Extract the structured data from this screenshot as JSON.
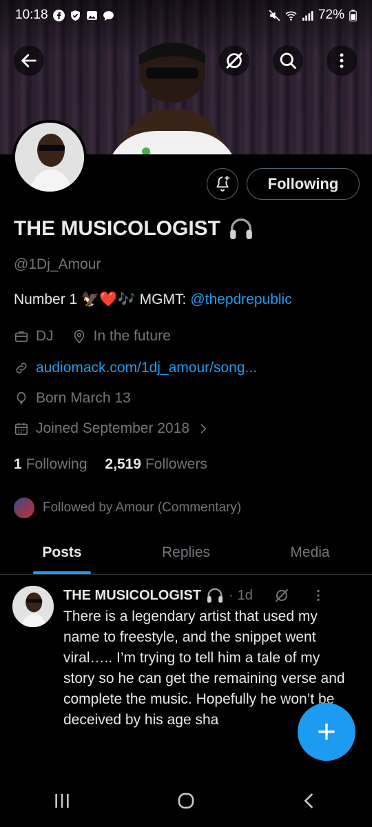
{
  "status": {
    "time": "10:18",
    "battery": "72%"
  },
  "profile": {
    "name": "THE MUSICOLOGIST",
    "handle": "@1Dj_Amour",
    "bio_prefix": "Number 1",
    "bio_emojis": "🦅❤️🎶",
    "bio_mgmt": "MGMT:",
    "bio_link": "@thepdrepublic",
    "category": "DJ",
    "location": "In the future",
    "website": "audiomack.com/1dj_amour/song...",
    "birthday": "Born March 13",
    "joined": "Joined September 2018",
    "following_count": "1",
    "following_label": "Following",
    "followers_count": "2,519",
    "followers_label": "Followers",
    "followed_by": "Followed by Amour (Commentary)"
  },
  "actions": {
    "follow_label": "Following"
  },
  "tabs": [
    {
      "label": "Posts",
      "active": true
    },
    {
      "label": "Replies",
      "active": false
    },
    {
      "label": "Media",
      "active": false
    }
  ],
  "post": {
    "author": "THE MUSICOLOGIST",
    "time": "1d",
    "dot": "·",
    "text": "There is a legendary artist that used my name to freestyle, and the snippet went viral….. I’m trying to tell him a tale of my story so he can get the remaining verse and complete the music. Hopefully he won’t be deceived by his age sha"
  },
  "fab": {
    "label": "+"
  },
  "colors": {
    "accent": "#1d9bf0",
    "muted": "#71767b",
    "text": "#e7e9ea",
    "border": "#536471"
  }
}
